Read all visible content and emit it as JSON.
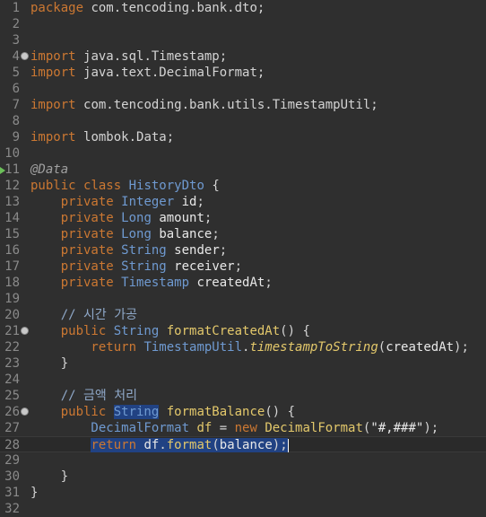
{
  "editor": {
    "lines": [
      {
        "n": "1",
        "tokens": [
          {
            "t": "package ",
            "c": "kw"
          },
          {
            "t": "com.tencoding.bank.dto;",
            "c": "pl"
          }
        ]
      },
      {
        "n": "2",
        "tokens": []
      },
      {
        "n": "3",
        "tokens": []
      },
      {
        "n": "4",
        "fold": true,
        "tokens": [
          {
            "t": "import ",
            "c": "kw"
          },
          {
            "t": "java.sql.Timestamp;",
            "c": "pl"
          }
        ]
      },
      {
        "n": "5",
        "tokens": [
          {
            "t": "import ",
            "c": "kw"
          },
          {
            "t": "java.text.DecimalFormat;",
            "c": "pl"
          }
        ]
      },
      {
        "n": "6",
        "tokens": []
      },
      {
        "n": "7",
        "tokens": [
          {
            "t": "import ",
            "c": "kw"
          },
          {
            "t": "com.tencoding.bank.utils.TimestampUtil;",
            "c": "pl"
          }
        ]
      },
      {
        "n": "8",
        "tokens": []
      },
      {
        "n": "9",
        "tokens": [
          {
            "t": "import ",
            "c": "kw"
          },
          {
            "t": "lombok.Data;",
            "c": "pl"
          }
        ]
      },
      {
        "n": "10",
        "tokens": []
      },
      {
        "n": "11",
        "marker": true,
        "tokens": [
          {
            "t": "@Data",
            "c": "an"
          }
        ]
      },
      {
        "n": "12",
        "tokens": [
          {
            "t": "public ",
            "c": "kw"
          },
          {
            "t": "class ",
            "c": "kw"
          },
          {
            "t": "HistoryDto",
            "c": "ty"
          },
          {
            "t": " {",
            "c": "pl"
          }
        ]
      },
      {
        "n": "13",
        "tokens": [
          {
            "t": "    private ",
            "c": "kw"
          },
          {
            "t": "Integer ",
            "c": "ty"
          },
          {
            "t": "id",
            "c": "va"
          },
          {
            "t": ";",
            "c": "pl"
          }
        ]
      },
      {
        "n": "14",
        "tokens": [
          {
            "t": "    private ",
            "c": "kw"
          },
          {
            "t": "Long ",
            "c": "ty"
          },
          {
            "t": "amount",
            "c": "va"
          },
          {
            "t": ";",
            "c": "pl"
          }
        ]
      },
      {
        "n": "15",
        "tokens": [
          {
            "t": "    private ",
            "c": "kw"
          },
          {
            "t": "Long ",
            "c": "ty"
          },
          {
            "t": "balance",
            "c": "va"
          },
          {
            "t": ";",
            "c": "pl"
          }
        ]
      },
      {
        "n": "16",
        "tokens": [
          {
            "t": "    private ",
            "c": "kw"
          },
          {
            "t": "String ",
            "c": "ty"
          },
          {
            "t": "sender",
            "c": "va"
          },
          {
            "t": ";",
            "c": "pl"
          }
        ]
      },
      {
        "n": "17",
        "tokens": [
          {
            "t": "    private ",
            "c": "kw"
          },
          {
            "t": "String ",
            "c": "ty"
          },
          {
            "t": "receiver",
            "c": "va"
          },
          {
            "t": ";",
            "c": "pl"
          }
        ]
      },
      {
        "n": "18",
        "tokens": [
          {
            "t": "    private ",
            "c": "kw"
          },
          {
            "t": "Timestamp ",
            "c": "ty"
          },
          {
            "t": "createdAt",
            "c": "va"
          },
          {
            "t": ";",
            "c": "pl"
          }
        ]
      },
      {
        "n": "19",
        "tokens": []
      },
      {
        "n": "20",
        "tokens": [
          {
            "t": "    // 시간 가공",
            "c": "cm"
          }
        ]
      },
      {
        "n": "21",
        "fold": true,
        "tokens": [
          {
            "t": "    public ",
            "c": "kw"
          },
          {
            "t": "String ",
            "c": "ty"
          },
          {
            "t": "formatCreatedAt",
            "c": "fn"
          },
          {
            "t": "() {",
            "c": "pl"
          }
        ]
      },
      {
        "n": "22",
        "tokens": [
          {
            "t": "        return ",
            "c": "kw"
          },
          {
            "t": "TimestampUtil",
            "c": "ty"
          },
          {
            "t": ".",
            "c": "pl"
          },
          {
            "t": "timestampToString",
            "c": "st-it"
          },
          {
            "t": "(",
            "c": "pl"
          },
          {
            "t": "createdAt",
            "c": "va"
          },
          {
            "t": ");",
            "c": "pl"
          }
        ]
      },
      {
        "n": "23",
        "tokens": [
          {
            "t": "    }",
            "c": "pl"
          }
        ]
      },
      {
        "n": "24",
        "tokens": []
      },
      {
        "n": "25",
        "tokens": [
          {
            "t": "    // 금액 처리",
            "c": "cm"
          }
        ]
      },
      {
        "n": "26",
        "fold": true,
        "tokens": [
          {
            "t": "    public ",
            "c": "kw"
          },
          {
            "t": "String",
            "c": "ty",
            "sel": true
          },
          {
            "t": " ",
            "c": "pl"
          },
          {
            "t": "formatBalance",
            "c": "fn"
          },
          {
            "t": "() {",
            "c": "pl"
          }
        ]
      },
      {
        "n": "27",
        "tokens": [
          {
            "t": "        DecimalFormat ",
            "c": "ty"
          },
          {
            "t": "df",
            "c": "fn"
          },
          {
            "t": " = ",
            "c": "pl"
          },
          {
            "t": "new ",
            "c": "kw"
          },
          {
            "t": "DecimalFormat",
            "c": "fn"
          },
          {
            "t": "(",
            "c": "pl"
          },
          {
            "t": "\"#,###\"",
            "c": "st"
          },
          {
            "t": ");",
            "c": "pl"
          }
        ]
      },
      {
        "n": "28",
        "current": true,
        "caret": true,
        "tokens": [
          {
            "t": "        ",
            "c": "pl"
          },
          {
            "t": "return ",
            "c": "kw",
            "sel": true
          },
          {
            "t": "df",
            "c": "va",
            "sel": true
          },
          {
            "t": ".",
            "c": "pl",
            "sel": true
          },
          {
            "t": "format",
            "c": "fn",
            "sel": true
          },
          {
            "t": "(",
            "c": "pl",
            "sel": true
          },
          {
            "t": "balance",
            "c": "va",
            "sel": true
          },
          {
            "t": ");",
            "c": "pl",
            "sel": true
          }
        ]
      },
      {
        "n": "29",
        "tokens": []
      },
      {
        "n": "30",
        "tokens": [
          {
            "t": "    }",
            "c": "pl"
          }
        ]
      },
      {
        "n": "31",
        "tokens": [
          {
            "t": "}",
            "c": "pl"
          }
        ]
      },
      {
        "n": "32",
        "tokens": []
      }
    ]
  }
}
